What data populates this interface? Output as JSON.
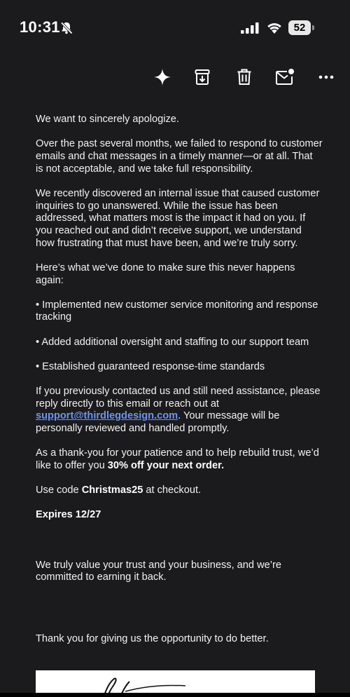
{
  "status_bar": {
    "time": "10:31",
    "battery": "52"
  },
  "toolbar": {
    "icons": [
      "sparkle-icon",
      "archive-icon",
      "trash-icon",
      "mark-unread-icon",
      "more-icon"
    ]
  },
  "email": {
    "p1": "We want to sincerely apologize.",
    "p2": "Over the past several months, we failed to respond to customer emails and chat messages in a timely manner—or at all. That is not acceptable, and we take full responsibility.",
    "p3": "We recently discovered an internal issue that caused customer inquiries to go unanswered. While the issue has been addressed, what matters most is the impact it had on you. If you reached out and didn’t receive support, we understand how frustrating that must have been, and we’re truly sorry.",
    "p4": "Here’s what we’ve done to make sure this never happens again:",
    "bullets": [
      "• Implemented new customer service monitoring and response tracking",
      "• Added additional oversight and staffing to our support team",
      "• Established guaranteed response-time standards"
    ],
    "p5_before": "If you previously contacted us and still need assistance, please reply directly to this email or reach out at ",
    "p5_link": "support@thirdlegdesign.com",
    "p5_after": ". Your message will be personally reviewed and handled promptly.",
    "p6_before": "As a thank-you for your patience and to help rebuild trust, we’d like to offer you ",
    "p6_bold": "30% off your next order.",
    "p7_before": "Use code ",
    "p7_code": "Christmas25",
    "p7_after": " at checkout.",
    "expires": "Expires 12/27",
    "p8": "We truly value your trust and your business, and we’re committed to earning it back.",
    "p9": "Thank you for giving us the opportunity to do better."
  },
  "colors": {
    "background": "#1b1b1d",
    "text": "#f2f2f2",
    "link": "#6d95f5"
  }
}
